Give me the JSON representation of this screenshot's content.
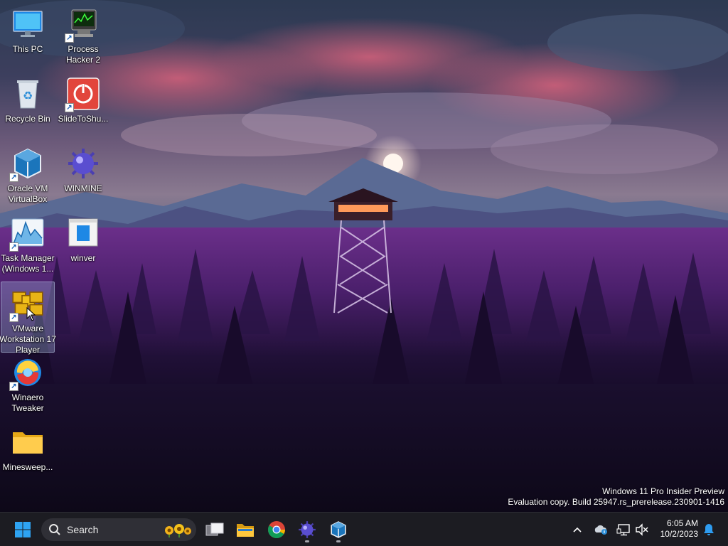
{
  "desktop": {
    "icons": [
      {
        "id": "this-pc",
        "label": "This PC",
        "icon": "monitor-icon",
        "shortcut": false
      },
      {
        "id": "process-hacker",
        "label": "Process Hacker 2",
        "icon": "process-monitor-icon",
        "shortcut": true
      },
      {
        "id": "recycle-bin",
        "label": "Recycle Bin",
        "icon": "recycle-bin-icon",
        "shortcut": false
      },
      {
        "id": "slidetoshutdown",
        "label": "SlideToShu...",
        "icon": "power-icon",
        "shortcut": true
      },
      {
        "id": "virtualbox",
        "label": "Oracle VM VirtualBox",
        "icon": "virtualbox-cube-icon",
        "shortcut": true
      },
      {
        "id": "winmine",
        "label": "WINMINE",
        "icon": "mine-icon",
        "shortcut": false
      },
      {
        "id": "task-manager",
        "label": "Task Manager (Windows 1...",
        "icon": "task-manager-chart-icon",
        "shortcut": true
      },
      {
        "id": "winver",
        "label": "winver",
        "icon": "winver-window-icon",
        "shortcut": false
      },
      {
        "id": "vmware",
        "label": "VMware Workstation 17 Player",
        "icon": "vmware-icon",
        "shortcut": true,
        "selected": true
      },
      {
        "id": "winaero",
        "label": "Winaero Tweaker",
        "icon": "winaero-swirl-icon",
        "shortcut": true
      },
      {
        "id": "minesweeper-folder",
        "label": "Minesweep...",
        "icon": "folder-icon",
        "shortcut": false
      }
    ]
  },
  "watermark": {
    "line1": "Windows 11 Pro Insider Preview",
    "line2": "Evaluation copy. Build 25947.rs_prerelease.230901-1416"
  },
  "taskbar": {
    "search_label": "Search",
    "apps": [
      {
        "name": "start",
        "icon": "windows-start-icon"
      },
      {
        "name": "task-view",
        "icon": "task-view-icon"
      },
      {
        "name": "file-explorer",
        "icon": "file-explorer-icon"
      },
      {
        "name": "chrome",
        "icon": "chrome-icon"
      },
      {
        "name": "winmine",
        "icon": "mine-icon",
        "running": true
      },
      {
        "name": "virtualbox",
        "icon": "virtualbox-cube-icon",
        "running": true
      }
    ],
    "tray": {
      "time": "6:05 AM",
      "date": "10/2/2023"
    }
  },
  "colors": {
    "taskbar_bg": "#1c1c22",
    "accent": "#0078d4"
  }
}
